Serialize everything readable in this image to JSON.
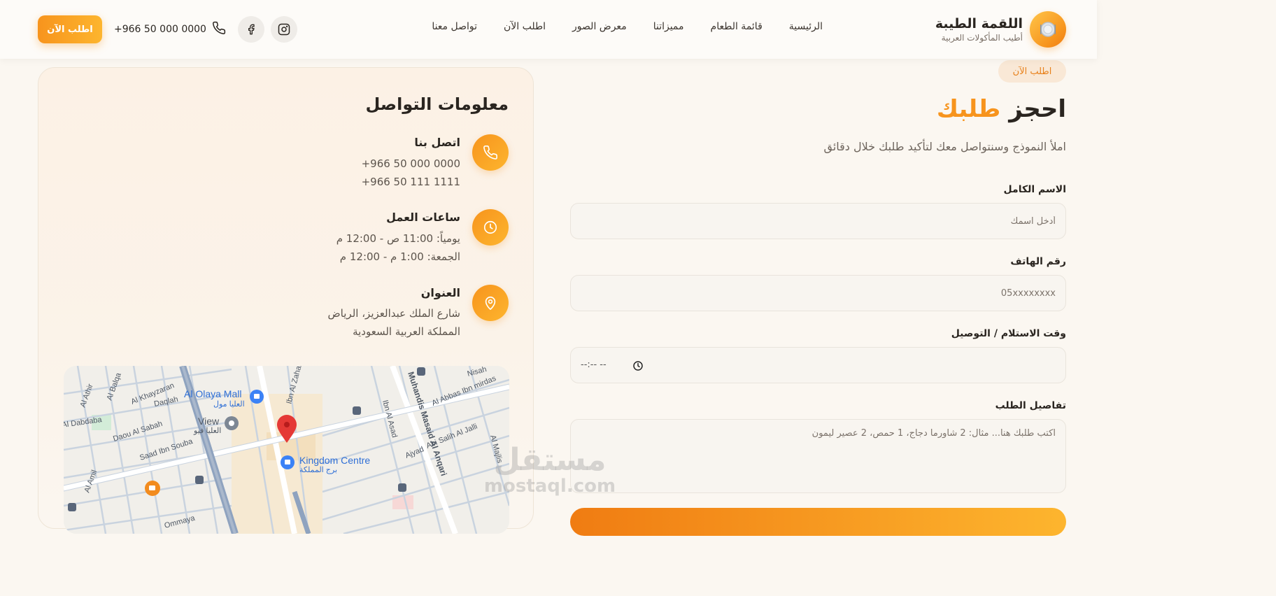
{
  "brand": {
    "name": "اللقمة الطيبة",
    "tagline": "أطيب المأكولات العربية"
  },
  "nav": {
    "items": [
      "الرئيسية",
      "قائمة الطعام",
      "مميزاتنا",
      "معرض الصور",
      "اطلب الآن",
      "تواصل معنا"
    ]
  },
  "header": {
    "cta_label": "اطلب الآن",
    "phone": "+966 50 000 0000"
  },
  "order": {
    "pill": "اطلب الآن",
    "title_main": "احجز",
    "title_accent": "طلبك",
    "subtitle": "املأ النموذج وسنتواصل معك لتأكيد طلبك خلال دقائق",
    "name_label": "الاسم الكامل",
    "name_placeholder": "أدخل اسمك",
    "phone_label": "رقم الهاتف",
    "phone_placeholder": "05xxxxxxxx",
    "time_label": "وقت الاستلام / التوصيل",
    "time_value": "--:-- --",
    "details_label": "تفاصيل الطلب",
    "details_placeholder": "اكتب طلبك هنا... مثال: 2 شاورما دجاج، 1 حمص، 2 عصير ليمون"
  },
  "contact": {
    "title": "معلومات التواصل",
    "call_title": "اتصل بنا",
    "phone_1": "+966 50 000 0000",
    "phone_2": "+966 50 111 1111",
    "hours_title": "ساعات العمل",
    "hours_daily": "يومياً: 11:00 ص - 12:00 م",
    "hours_friday": "الجمعة: 1:00 م - 12:00 م",
    "address_title": "العنوان",
    "address_line_1": "شارع الملك عبدالعزيز، الرياض",
    "address_line_2": "المملكة العربية السعودية"
  },
  "map": {
    "labels": {
      "olaya_mall": "Al Olaya Mall",
      "olaya_mall_ar": "العليا مول",
      "view": "View",
      "view_ar": "العليا فيو",
      "kingdom_centre": "Kingdom Centre",
      "kingdom_centre_ar": "برج المملكة",
      "muhandis": "Muhandis Masaid Al Anqari",
      "ibn_al_asad": "Ibn Al Asad",
      "al_abbas": "Al Abbas Ibn mirdas",
      "nisah": "Nisah",
      "abi_salih": "Abi Salih Al Jalli",
      "al_majlis": "Al Majlis",
      "ajyad": "Ajyad",
      "al_khayzaran": "Al Khayzaran",
      "daqlah": "Daqlah",
      "al_balqa": "Al Balqa",
      "al_athir": "Al Athir",
      "al_dabdaba": "Al Dabdaba",
      "daou_al_sabah": "Daou Al Sabah",
      "saad_ibn_souba": "Saad Ibn Souba",
      "al_amil": "Al Amil",
      "ommaya": "Ommaya",
      "ibn_al_zahabi": "Ibn Al Zahabi"
    }
  },
  "watermark": {
    "ar": "مستقل",
    "en": "mostaql.com"
  },
  "colors": {
    "accent": "#f7941d",
    "accent_light": "#fdb52e",
    "background": "#fbf7f1",
    "pill_bg": "#f9e8d6"
  },
  "icons": [
    "plate-icon",
    "phone-icon",
    "facebook-icon",
    "instagram-icon",
    "clock-icon",
    "location-pin-icon"
  ]
}
